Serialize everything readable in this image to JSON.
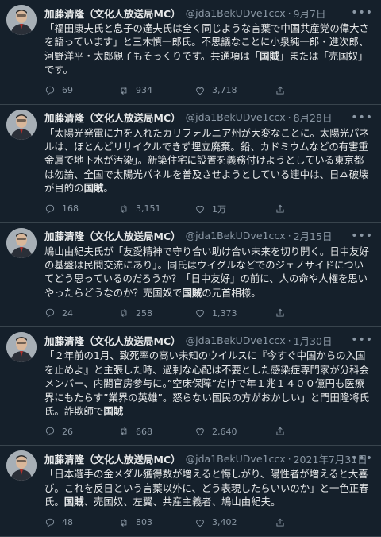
{
  "tweets": [
    {
      "name": "加藤清隆（文化人放送局MC）",
      "handle": "@jda1BekUDve1ccx",
      "separator": "·",
      "date": "9月7日",
      "text_segments": [
        {
          "t": "「福田康夫氏と息子の達夫氏は全く同じような言葉で中国共産党の偉大さを語っています」と三木慎一郎氏。不思議なことに小泉純一郎・進次郎、河野洋平・太郎親子もそっくりです。共通項は「",
          "b": false
        },
        {
          "t": "国賊",
          "b": true
        },
        {
          "t": "」または「売国奴」です。",
          "b": false
        }
      ],
      "replies": "69",
      "retweets": "934",
      "likes": "3,718"
    },
    {
      "name": "加藤清隆（文化人放送局MC）",
      "handle": "@jda1BekUDve1ccx",
      "separator": "·",
      "date": "8月28日",
      "text_segments": [
        {
          "t": "「太陽光発電に力を入れたカリフォルニア州が大変なことに。太陽光パネルは、ほとんどリサイクルできず埋立廃棄。鉛、カドミウムなどの有害重金属で地下水が汚染」。新築住宅に設置を義務付けようとしている東京都は勿論、全国で太陽光パネルを普及させようとしている連中は、日本破壊が目的の",
          "b": false
        },
        {
          "t": "国賊",
          "b": true
        },
        {
          "t": "。",
          "b": false
        }
      ],
      "replies": "168",
      "retweets": "3,151",
      "likes": "1万"
    },
    {
      "name": "加藤清隆（文化人放送局MC）",
      "handle": "@jda1BekUDve1ccx",
      "separator": "·",
      "date": "2月15日",
      "text_segments": [
        {
          "t": "鳩山由紀夫氏が「友愛精神で守り合い助け合い未来を切り開く。日中友好の基盤は民間交流にあり」。同氏はウイグルなどでのジェノサイドについてどう思っているのだろうか？「日中友好」の前に、人の命や人権を思いやったらどうなのか？売国奴で",
          "b": false
        },
        {
          "t": "国賊",
          "b": true
        },
        {
          "t": "の元首相様。",
          "b": false
        }
      ],
      "replies": "24",
      "retweets": "258",
      "likes": "1,373"
    },
    {
      "name": "加藤清隆（文化人放送局MC）",
      "handle": "@jda1BekUDve1ccx",
      "separator": "·",
      "date": "1月30日",
      "text_segments": [
        {
          "t": "「２年前の1月、致死率の高い未知のウイルスに『今すぐ中国からの入国を止めよ』と主張した時、過剰な心配は不要とした感染症専門家が分科会メンバー、内閣官房参与に。”空床保障”だけで年１兆１４００億円も医療界にもたらす”業界の英雄”。怒らない国民の方がおかしい」と門田隆将氏氏。詐欺師で",
          "b": false
        },
        {
          "t": "国賊",
          "b": true
        }
      ],
      "replies": "26",
      "retweets": "668",
      "likes": "2,640"
    },
    {
      "name": "加藤清隆（文化人放送局MC）",
      "handle": "@jda1BekUDve1ccx",
      "separator": "·",
      "date": "2021年7月31日",
      "text_segments": [
        {
          "t": "「日本選手の金メダル獲得数が増えると悔しがり、陽性者が増えると大喜び。これを反日という言葉以外に、どう表現したらいいのか」と一色正春氏。",
          "b": false
        },
        {
          "t": "国賊",
          "b": true
        },
        {
          "t": "、売国奴、左翼、共産主義者、鳩山由紀夫。",
          "b": false
        }
      ],
      "replies": "48",
      "retweets": "803",
      "likes": "3,402"
    }
  ],
  "icons": {
    "more": "more-dots-icon",
    "reply": "reply-icon",
    "retweet": "retweet-icon",
    "like": "heart-icon",
    "share": "share-icon"
  },
  "colors": {
    "background": "#15202b",
    "text": "#e7e9ea",
    "secondary": "#8b98a5",
    "divider": "#38444d"
  }
}
